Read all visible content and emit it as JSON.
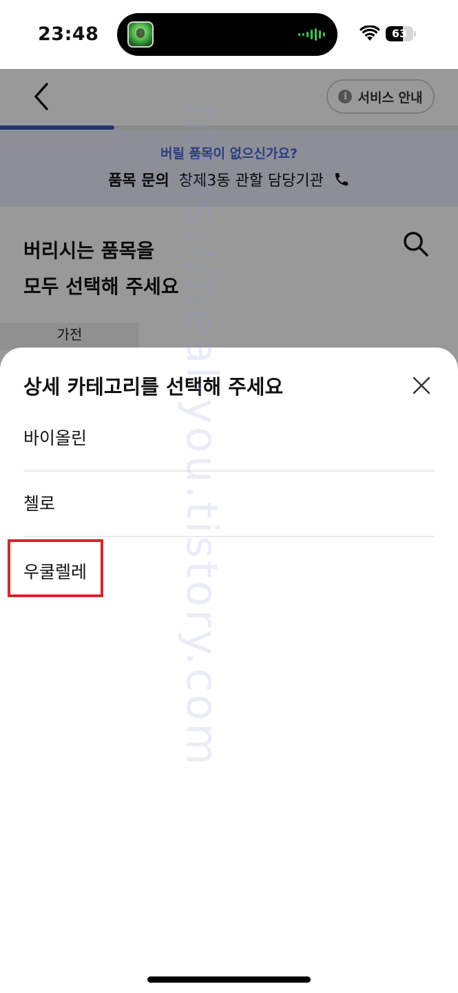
{
  "status_bar": {
    "time": "23:48",
    "battery": "63",
    "battery_level": 0.63,
    "icons": [
      "voice-app-icon",
      "audio-wave-icon",
      "wifi-icon",
      "battery-icon"
    ]
  },
  "header": {
    "back_icon": "chevron-left-icon",
    "service_button_label": "서비스 안내",
    "service_button_icon": "info-icon",
    "progress": 0.25
  },
  "banner": {
    "question": "버릴 품목이 없으신가요?",
    "label": "품목 문의",
    "agency": "창제3동 관할 담당기관",
    "phone_icon": "phone-icon"
  },
  "main": {
    "title_line1": "버리시는 품목을",
    "title_line2": "모두 선택해 주세요",
    "search_icon": "search-icon",
    "category_tab": "가전"
  },
  "sheet": {
    "title": "상세 카테고리를 선택해 주세요",
    "close_icon": "close-icon",
    "options": [
      {
        "label": "바이올린"
      },
      {
        "label": "첼로"
      },
      {
        "label": "우쿨렐레"
      }
    ],
    "highlighted_option": "우쿨렐레",
    "highlight_color": "#d9252c"
  },
  "watermark": "https://heal-you.tistory.com",
  "colors": {
    "accent": "#3b52c4",
    "banner_bg": "#e9eefb",
    "banner_question": "#4a64d6"
  }
}
